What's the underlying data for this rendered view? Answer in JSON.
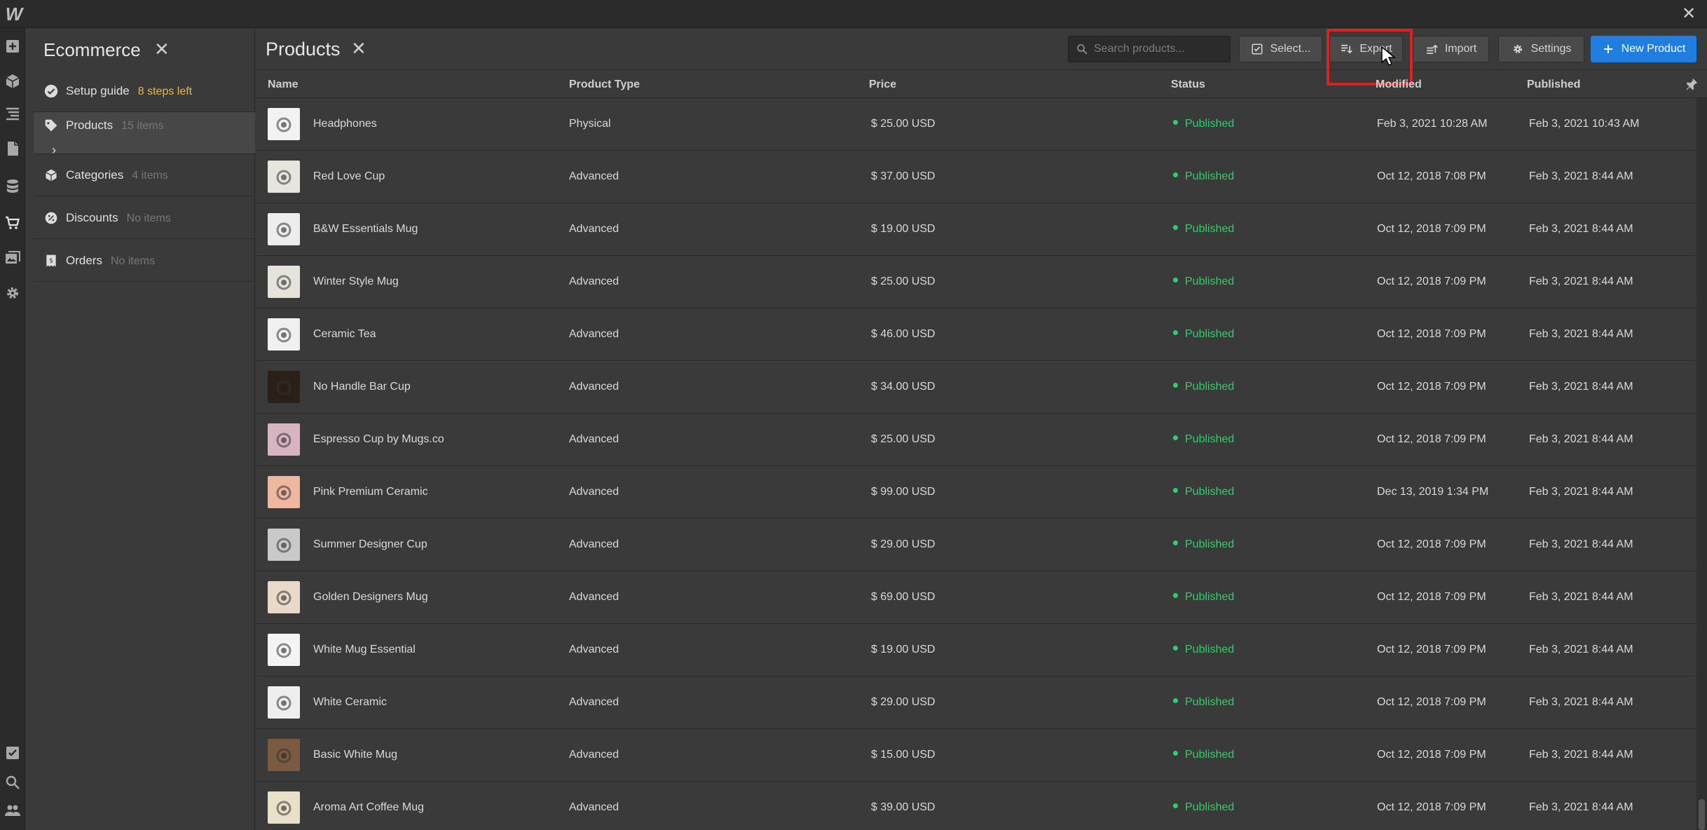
{
  "app": {
    "logo": "W",
    "window_close": "✕"
  },
  "rail": {
    "top_icons": [
      "add-panel-icon",
      "cube-icon",
      "navigator-icon",
      "pages-icon",
      "cms-icon",
      "ecommerce-cart-icon",
      "assets-icon",
      "settings-icon"
    ],
    "bottom_icons": [
      "tasks-icon",
      "search-icon",
      "users-icon"
    ]
  },
  "sidebar": {
    "title": "Ecommerce",
    "close": "✕",
    "items": [
      {
        "label": "Setup guide",
        "sub": "8 steps left",
        "icon": "check-circle-icon"
      },
      {
        "label": "Products",
        "sub": "15 items",
        "icon": "tag-icon",
        "expand": "›"
      },
      {
        "label": "Categories",
        "sub": "4 items",
        "icon": "box-icon"
      },
      {
        "label": "Discounts",
        "sub": "No items",
        "icon": "discount-icon"
      },
      {
        "label": "Orders",
        "sub": "No items",
        "icon": "receipt-icon"
      }
    ]
  },
  "header": {
    "title": "Products",
    "close": "✕",
    "search_placeholder": "Search products...",
    "buttons": {
      "select": "Select...",
      "export": "Export",
      "import": "Import",
      "settings": "Settings",
      "new_product": "New Product"
    }
  },
  "table": {
    "columns": [
      "Name",
      "Product Type",
      "Price",
      "Status",
      "Modified",
      "Published"
    ],
    "rows": [
      {
        "name": "Headphones",
        "type": "Physical",
        "price": "$ 25.00 USD",
        "status": "Published",
        "modified": "Feb 3, 2021 10:28 AM",
        "published": "Feb 3, 2021 10:43 AM",
        "thumb": "#f2f2f2"
      },
      {
        "name": "Red Love Cup",
        "type": "Advanced",
        "price": "$ 37.00 USD",
        "status": "Published",
        "modified": "Oct 12, 2018 7:08 PM",
        "published": "Feb 3, 2021 8:44 AM",
        "thumb": "#e8e4de"
      },
      {
        "name": "B&W Essentials Mug",
        "type": "Advanced",
        "price": "$ 19.00 USD",
        "status": "Published",
        "modified": "Oct 12, 2018 7:09 PM",
        "published": "Feb 3, 2021 8:44 AM",
        "thumb": "#ededed"
      },
      {
        "name": "Winter Style Mug",
        "type": "Advanced",
        "price": "$ 25.00 USD",
        "status": "Published",
        "modified": "Oct 12, 2018 7:09 PM",
        "published": "Feb 3, 2021 8:44 AM",
        "thumb": "#e6e2dc"
      },
      {
        "name": "Ceramic Tea",
        "type": "Advanced",
        "price": "$ 46.00 USD",
        "status": "Published",
        "modified": "Oct 12, 2018 7:09 PM",
        "published": "Feb 3, 2021 8:44 AM",
        "thumb": "#f0f0f0"
      },
      {
        "name": "No Handle Bar Cup",
        "type": "Advanced",
        "price": "$ 34.00 USD",
        "status": "Published",
        "modified": "Oct 12, 2018 7:09 PM",
        "published": "Feb 3, 2021 8:44 AM",
        "thumb": "#2a2018"
      },
      {
        "name": "Espresso Cup by Mugs.co",
        "type": "Advanced",
        "price": "$ 25.00 USD",
        "status": "Published",
        "modified": "Oct 12, 2018 7:09 PM",
        "published": "Feb 3, 2021 8:44 AM",
        "thumb": "#d8b3c2"
      },
      {
        "name": "Pink Premium Ceramic",
        "type": "Advanced",
        "price": "$ 99.00 USD",
        "status": "Published",
        "modified": "Dec 13, 2019 1:34 PM",
        "published": "Feb 3, 2021 8:44 AM",
        "thumb": "#efb7a0"
      },
      {
        "name": "Summer Designer Cup",
        "type": "Advanced",
        "price": "$ 29.00 USD",
        "status": "Published",
        "modified": "Oct 12, 2018 7:09 PM",
        "published": "Feb 3, 2021 8:44 AM",
        "thumb": "#c9c9c9"
      },
      {
        "name": "Golden Designers Mug",
        "type": "Advanced",
        "price": "$ 69.00 USD",
        "status": "Published",
        "modified": "Oct 12, 2018 7:09 PM",
        "published": "Feb 3, 2021 8:44 AM",
        "thumb": "#ead8c8"
      },
      {
        "name": "White Mug Essential",
        "type": "Advanced",
        "price": "$ 19.00 USD",
        "status": "Published",
        "modified": "Oct 12, 2018 7:09 PM",
        "published": "Feb 3, 2021 8:44 AM",
        "thumb": "#f4f4f4"
      },
      {
        "name": "White Ceramic",
        "type": "Advanced",
        "price": "$ 29.00 USD",
        "status": "Published",
        "modified": "Oct 12, 2018 7:09 PM",
        "published": "Feb 3, 2021 8:44 AM",
        "thumb": "#eeeeee"
      },
      {
        "name": "Basic White Mug",
        "type": "Advanced",
        "price": "$ 15.00 USD",
        "status": "Published",
        "modified": "Oct 12, 2018 7:09 PM",
        "published": "Feb 3, 2021 8:44 AM",
        "thumb": "#7a5a40"
      },
      {
        "name": "Aroma Art Coffee Mug",
        "type": "Advanced",
        "price": "$ 39.00 USD",
        "status": "Published",
        "modified": "Oct 12, 2018 7:09 PM",
        "published": "Feb 3, 2021 8:44 AM",
        "thumb": "#e8e0c8"
      }
    ]
  },
  "colors": {
    "accent": "#1f7ee0",
    "published": "#2fcf6a",
    "warning": "#e5b84c",
    "highlight": "#e01f1f"
  }
}
